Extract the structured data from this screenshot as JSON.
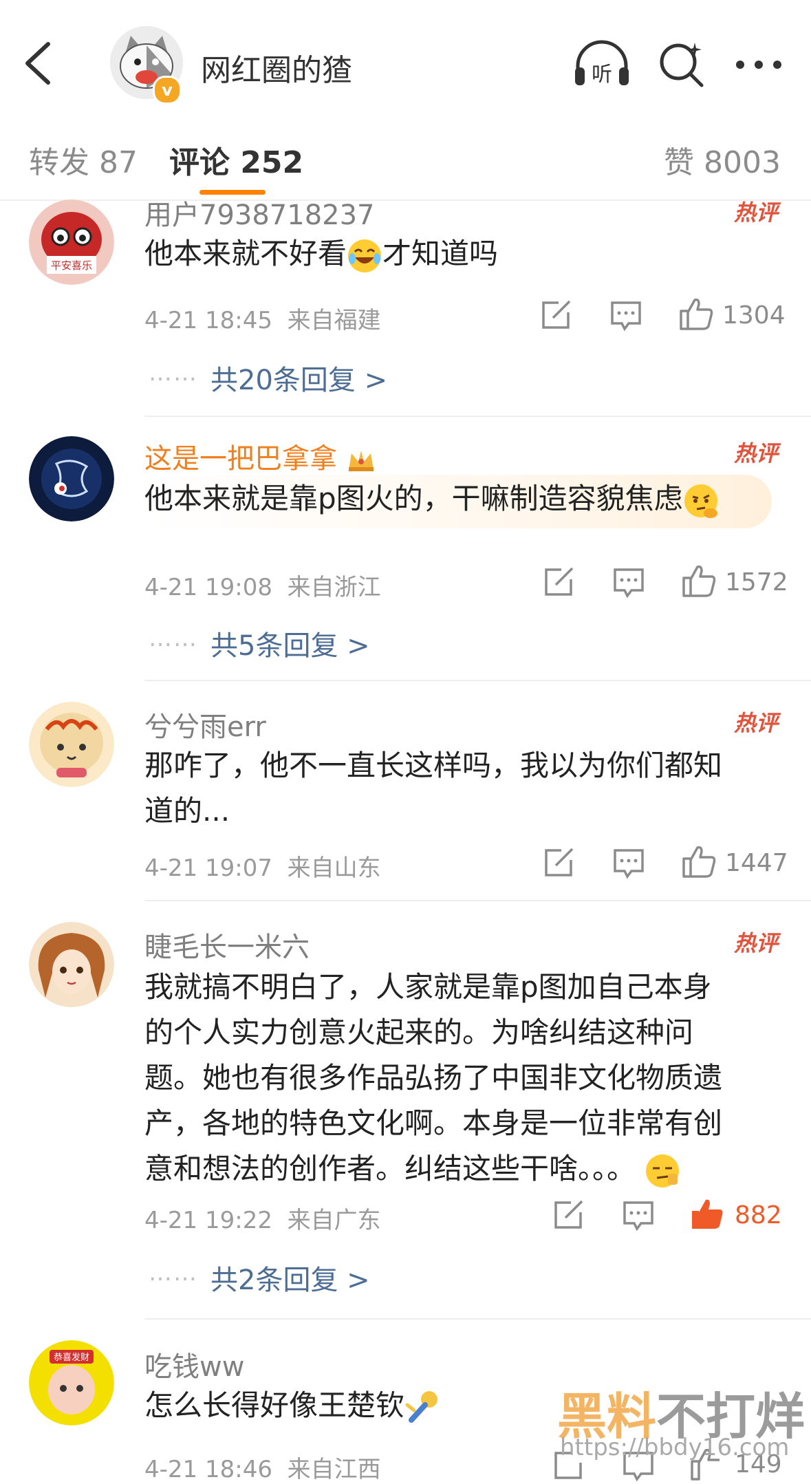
{
  "header": {
    "title": "网红圈的猹",
    "listen_label": "听",
    "verified_mark": "v"
  },
  "tabs": [
    {
      "label": "转发 87"
    },
    {
      "label": "评论 252"
    },
    {
      "label": "赞 8003"
    }
  ],
  "hot_label": "热评",
  "comments": [
    {
      "name": "用户7938718237",
      "text_before": "他本来就不好看",
      "text_after": "才知道吗",
      "emoji": "laugh-tears-emoji",
      "time": "4-21 18:45",
      "location": "来自福建",
      "likes": "1304",
      "replies": "共20条回复 >",
      "avatar_text": "平安喜乐"
    },
    {
      "name": "这是一把巴拿拿",
      "badge": "crown-icon",
      "text": "他本来就是靠p图火的，干嘛制造容貌焦虑",
      "emoji": "thinking-emoji",
      "time": "4-21 19:08",
      "location": "来自浙江",
      "likes": "1572",
      "replies": "共5条回复 >"
    },
    {
      "name": "兮兮雨err",
      "text_line1": "那咋了，他不一直长这样吗，我以为你们都知",
      "text_line2": "道的...",
      "time": "4-21 19:07",
      "location": "来自山东",
      "likes": "1447"
    },
    {
      "name": "睫毛长一米六",
      "text_lines": [
        "我就搞不明白了，人家就是靠p图加自己本身",
        "的个人实力创意火起来的。为啥纠结这种问",
        "题。她也有很多作品弘扬了中国非文化物质遗",
        "产，各地的特色文化啊。本身是一位非常有创",
        "意和想法的创作者。纠结这些干啥。。。"
      ],
      "emoji": "smirk-emoji",
      "time": "4-21 19:22",
      "location": "来自广东",
      "likes": "882",
      "replies": "共2条回复 >"
    },
    {
      "name": "吃钱ww",
      "text": "怎么长得好像王楚钦",
      "emoji": "table-tennis-emoji",
      "time": "4-21 18:46",
      "location": "来自江西",
      "likes": "149",
      "avatar_text": "恭喜发财"
    }
  ],
  "dots": "……",
  "watermark": {
    "brand_highlight": "黑料",
    "brand_rest": "不打烊",
    "url": "https://bbdy16.com"
  },
  "colors": {
    "accent": "#ff8200",
    "reply_link": "#4d6d94",
    "hot": "#e0533c",
    "liked": "#f05a28"
  }
}
